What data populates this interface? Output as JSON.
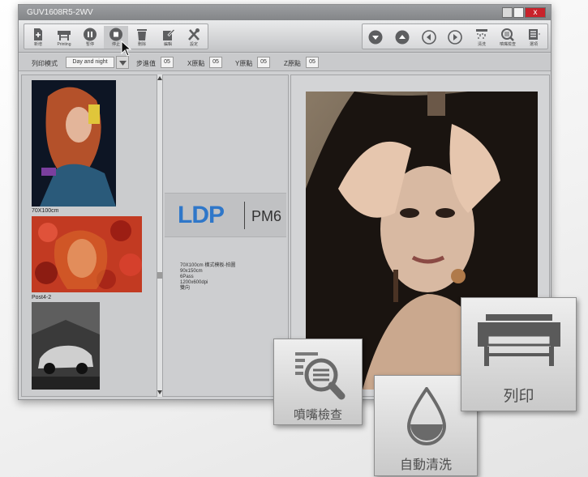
{
  "window": {
    "title": "GUV1608R5-2WV",
    "close_glyph": "x"
  },
  "toolbar": {
    "buttons": [
      {
        "label": "新增",
        "icon": "add-file-icon"
      },
      {
        "label": "Printing",
        "icon": "printer-icon"
      },
      {
        "label": "暫停",
        "icon": "pause-icon"
      },
      {
        "label": "停止",
        "icon": "stop-icon"
      },
      {
        "label": "刪除",
        "icon": "trash-icon"
      },
      {
        "label": "編輯",
        "icon": "edit-icon"
      },
      {
        "label": "設定",
        "icon": "tools-icon"
      }
    ],
    "nav": [
      {
        "icon": "arrow-down-circle-icon"
      },
      {
        "icon": "arrow-up-circle-icon"
      },
      {
        "icon": "arrow-left-circle-icon"
      },
      {
        "icon": "arrow-right-circle-icon"
      }
    ],
    "right": [
      {
        "label": "清洗",
        "icon": "clean-icon"
      },
      {
        "label": "噴嘴檢查",
        "icon": "nozzle-check-icon"
      },
      {
        "label": "選項",
        "icon": "options-icon"
      }
    ]
  },
  "options": {
    "print_mode_label": "列印模式",
    "print_mode_value": "Day and night",
    "step_label": "步進值",
    "step_value": "05",
    "x_origin_label": "X原點",
    "x_origin_value": "05",
    "y_origin_label": "Y原點",
    "y_origin_value": "05",
    "z_origin_label": "Z原點",
    "z_origin_value": "05"
  },
  "thumbnails": [
    {
      "caption": "70X100cm"
    },
    {
      "caption": "Post4-2"
    },
    {
      "caption": ""
    }
  ],
  "logo": {
    "brand": "LDP",
    "model": "PM6"
  },
  "job_info": [
    "70X100cm 橫式模板-拍圖",
    "90x150cm",
    "6Pass",
    "1200x600dpi",
    "雙向"
  ],
  "overlay_buttons": {
    "nozzle_check": "噴嘴檢查",
    "auto_clean": "自動清洗",
    "print": "列印"
  },
  "colors": {
    "accent_blue": "#2f77c9",
    "close_red": "#c8222b"
  }
}
